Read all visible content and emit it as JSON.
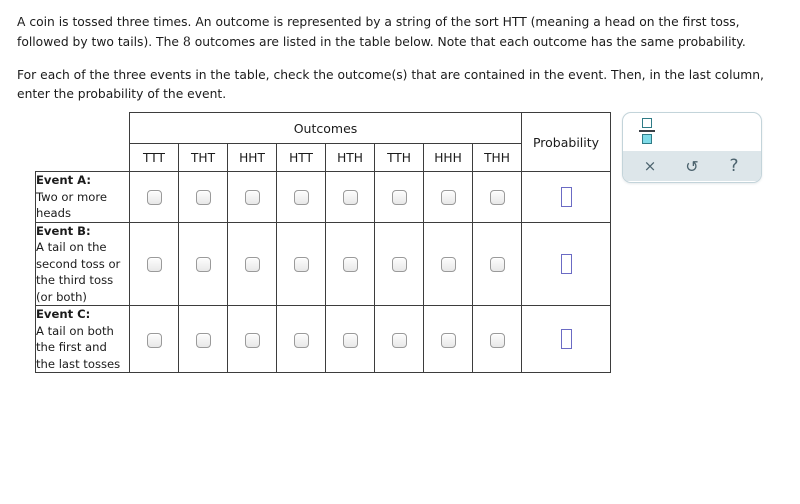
{
  "instructions": {
    "paragraph1_before": "A coin is tossed three times. An outcome is represented by a string of the sort HTT (meaning a head on the first toss, followed by two tails). The ",
    "paragraph1_number": "8",
    "paragraph1_after": " outcomes are listed in the table below. Note that each outcome has the same probability.",
    "paragraph2": "For each of the three events in the table, check the outcome(s) that are contained in the event. Then, in the last column, enter the probability of the event."
  },
  "table": {
    "outcomes_header": "Outcomes",
    "probability_header": "Probability",
    "columns": [
      "TTT",
      "THT",
      "HHT",
      "HTT",
      "HTH",
      "TTH",
      "HHH",
      "THH"
    ],
    "rows": [
      {
        "title": "Event A:",
        "description": "Two or more heads",
        "checked": [
          false,
          false,
          false,
          false,
          false,
          false,
          false,
          false
        ],
        "probability_value": ""
      },
      {
        "title": "Event B:",
        "description": "A tail on the second toss or the third toss (or both)",
        "checked": [
          false,
          false,
          false,
          false,
          false,
          false,
          false,
          false
        ],
        "probability_value": ""
      },
      {
        "title": "Event C:",
        "description": "A tail on both the first and the last tosses",
        "checked": [
          false,
          false,
          false,
          false,
          false,
          false,
          false,
          false
        ],
        "probability_value": ""
      }
    ]
  },
  "math_widget": {
    "fraction_button_name": "fraction-template",
    "tools": [
      {
        "icon": "close-icon",
        "glyph": "×"
      },
      {
        "icon": "undo-icon",
        "glyph": "↺"
      },
      {
        "icon": "help-icon",
        "glyph": "?"
      }
    ]
  },
  "colors": {
    "table_border": "#3d3d3d",
    "answer_box_border": "#6b6bc4",
    "widget_accent": "#7fdbe8",
    "widget_toolbar": "#dde6ea"
  }
}
